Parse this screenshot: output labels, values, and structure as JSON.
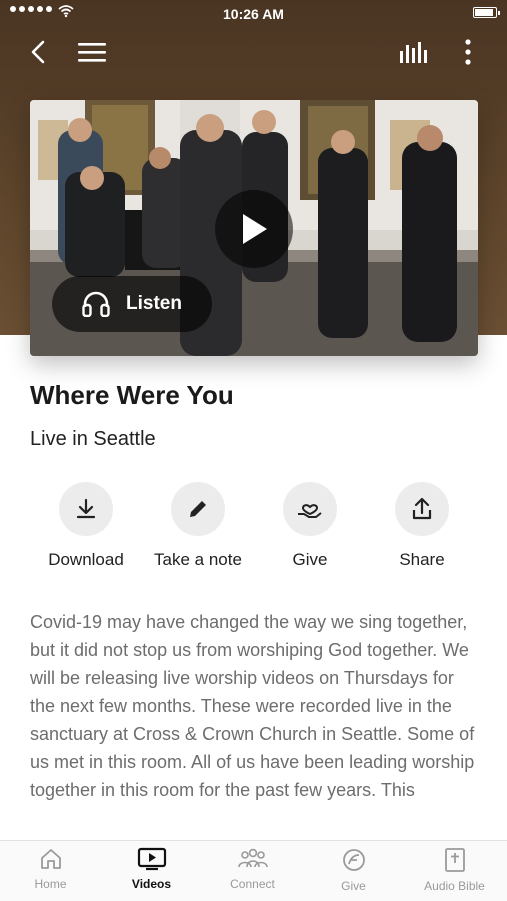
{
  "status_bar": {
    "time": "10:26 AM",
    "signal_icon": "signal-dots-icon",
    "wifi_icon": "wifi-icon",
    "battery_icon": "battery-icon"
  },
  "top_bar": {
    "back_icon": "chevron-left-icon",
    "menu_icon": "hamburger-menu-icon",
    "audio_icon": "equalizer-icon",
    "more_icon": "more-vertical-icon"
  },
  "media": {
    "play_icon": "play-icon",
    "listen_label": "Listen",
    "listen_icon": "headphones-icon"
  },
  "content": {
    "title": "Where Were You",
    "subtitle": "Live in Seattle",
    "description": "Covid-19 may have changed the way we sing together, but it did not stop us from worshiping God together. We will be releasing live worship videos on Thursdays for the next few months. These were recorded live in the sanctuary at Cross & Crown Church in Seattle. Some of us met in this room. All of us have been leading worship together in this room for the past few years. This"
  },
  "actions": [
    {
      "label": "Download",
      "icon": "download-icon"
    },
    {
      "label": "Take a note",
      "icon": "pencil-icon"
    },
    {
      "label": "Give",
      "icon": "give-heart-hand-icon"
    },
    {
      "label": "Share",
      "icon": "share-icon"
    }
  ],
  "tabs": [
    {
      "label": "Home",
      "icon": "home-icon",
      "active": false
    },
    {
      "label": "Videos",
      "icon": "tv-play-icon",
      "active": true
    },
    {
      "label": "Connect",
      "icon": "people-icon",
      "active": false
    },
    {
      "label": "Give",
      "icon": "give-icon",
      "active": false
    },
    {
      "label": "Audio Bible",
      "icon": "bible-icon",
      "active": false
    }
  ],
  "colors": {
    "header_brown": "#5e452b",
    "text_dark": "#1a1a1a",
    "text_gray": "#6d6d6d",
    "action_circle": "#ececec"
  }
}
